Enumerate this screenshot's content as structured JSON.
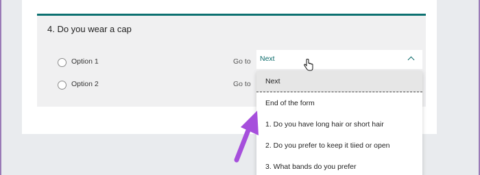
{
  "question": {
    "title": "4. Do you wear a cap",
    "options": [
      {
        "label": "Option 1",
        "goto_label": "Go to"
      },
      {
        "label": "Option 2",
        "goto_label": "Go to"
      }
    ]
  },
  "goto_select": {
    "selected": "Next",
    "options": [
      "Next",
      "End of the form",
      "1. Do you have long hair or short hair",
      "2. Do you prefer to keep it tiied or open",
      "3. What bands do you prefer"
    ]
  },
  "colors": {
    "accent": "#0b7070",
    "annotation_arrow": "#a64fdc"
  },
  "icons": {
    "cursor": "hand-pointer-icon",
    "chevron": "chevron-up-icon"
  }
}
